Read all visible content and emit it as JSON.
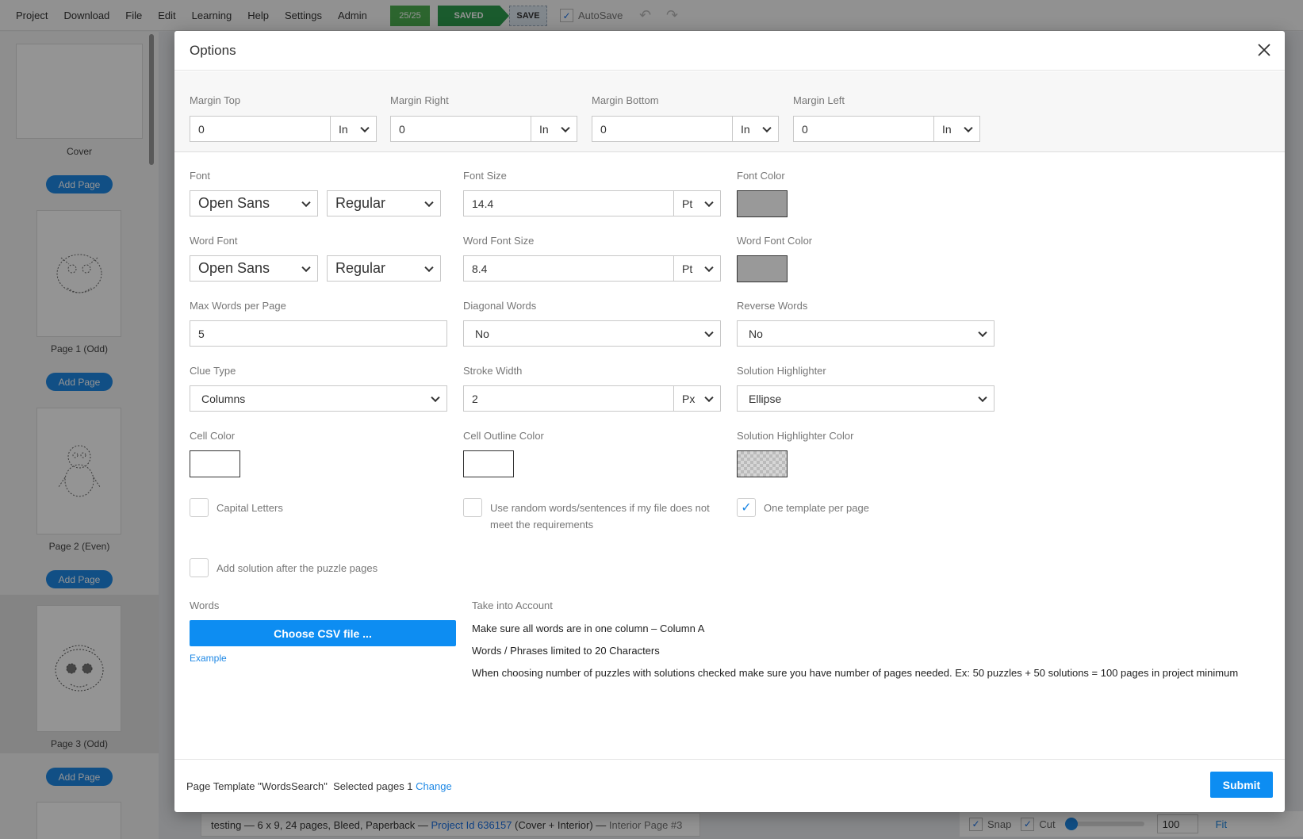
{
  "menu": [
    "Project",
    "Download",
    "File",
    "Edit",
    "Learning",
    "Help",
    "Settings",
    "Admin"
  ],
  "toolbar": {
    "count": "25/25",
    "saved": "SAVED",
    "save": "SAVE",
    "autosave": "AutoSave"
  },
  "sidebar": {
    "cover_label": "Cover",
    "add_page": "Add Page",
    "pages": [
      "Page 1 (Odd)",
      "Page 2 (Even)",
      "Page 3 (Odd)"
    ]
  },
  "status": {
    "name": "testing",
    "details": " — 6 x 9, 24 pages, Bleed, Paperback — ",
    "project_link": "Project Id 636157",
    "scope": " (Cover + Interior) — ",
    "page": "Interior Page #3"
  },
  "tools": {
    "snap": "Snap",
    "cut": "Cut",
    "zoom": "100",
    "fit": "Fit"
  },
  "modal": {
    "title": "Options",
    "margins": [
      {
        "label": "Margin Top",
        "value": "0",
        "unit": "In"
      },
      {
        "label": "Margin Right",
        "value": "0",
        "unit": "In"
      },
      {
        "label": "Margin Bottom",
        "value": "0",
        "unit": "In"
      },
      {
        "label": "Margin Left",
        "value": "0",
        "unit": "In"
      }
    ],
    "font": {
      "label": "Font",
      "family": "Open Sans",
      "style": "Regular"
    },
    "font_size": {
      "label": "Font Size",
      "value": "14.4",
      "unit": "Pt"
    },
    "font_color": {
      "label": "Font Color",
      "color": "#999999"
    },
    "word_font": {
      "label": "Word Font",
      "family": "Open Sans",
      "style": "Regular"
    },
    "word_font_size": {
      "label": "Word Font Size",
      "value": "8.4",
      "unit": "Pt"
    },
    "word_font_color": {
      "label": "Word Font Color",
      "color": "#999999"
    },
    "max_words": {
      "label": "Max Words per Page",
      "value": "5"
    },
    "diagonal_words": {
      "label": "Diagonal Words",
      "value": "No"
    },
    "reverse_words": {
      "label": "Reverse Words",
      "value": "No"
    },
    "clue_type": {
      "label": "Clue Type",
      "value": "Columns"
    },
    "stroke_width": {
      "label": "Stroke Width",
      "value": "2",
      "unit": "Px"
    },
    "solution_highlighter": {
      "label": "Solution Highlighter",
      "value": "Ellipse"
    },
    "cell_color": {
      "label": "Cell Color",
      "color": "#ffffff"
    },
    "cell_outline_color": {
      "label": "Cell Outline Color",
      "color": "#ffffff"
    },
    "solution_highlighter_color": {
      "label": "Solution Highlighter Color",
      "color": "#c8c8c8"
    },
    "capital_letters": {
      "label": "Capital Letters",
      "checked": false
    },
    "random_words": {
      "label": "Use random words/sentences if my file does not meet the requirements",
      "checked": false
    },
    "one_template": {
      "label": "One template per page",
      "checked": true
    },
    "add_solution": {
      "label": "Add solution after the puzzle pages",
      "checked": false
    },
    "words": {
      "label": "Words",
      "button": "Choose CSV file ...",
      "example": "Example"
    },
    "notes": {
      "label": "Take into Account",
      "items": [
        "Make sure all words are in one column – Column A",
        "Words / Phrases limited to 20 Characters",
        "When choosing number of puzzles with solutions checked make sure you have number of pages needed. Ex: 50 puzzles + 50 solutions = 100 pages in project minimum"
      ]
    },
    "footer": {
      "template_text": "Page Template \"WordsSearch\"  Selected pages 1 ",
      "change": "Change",
      "submit": "Submit"
    }
  }
}
